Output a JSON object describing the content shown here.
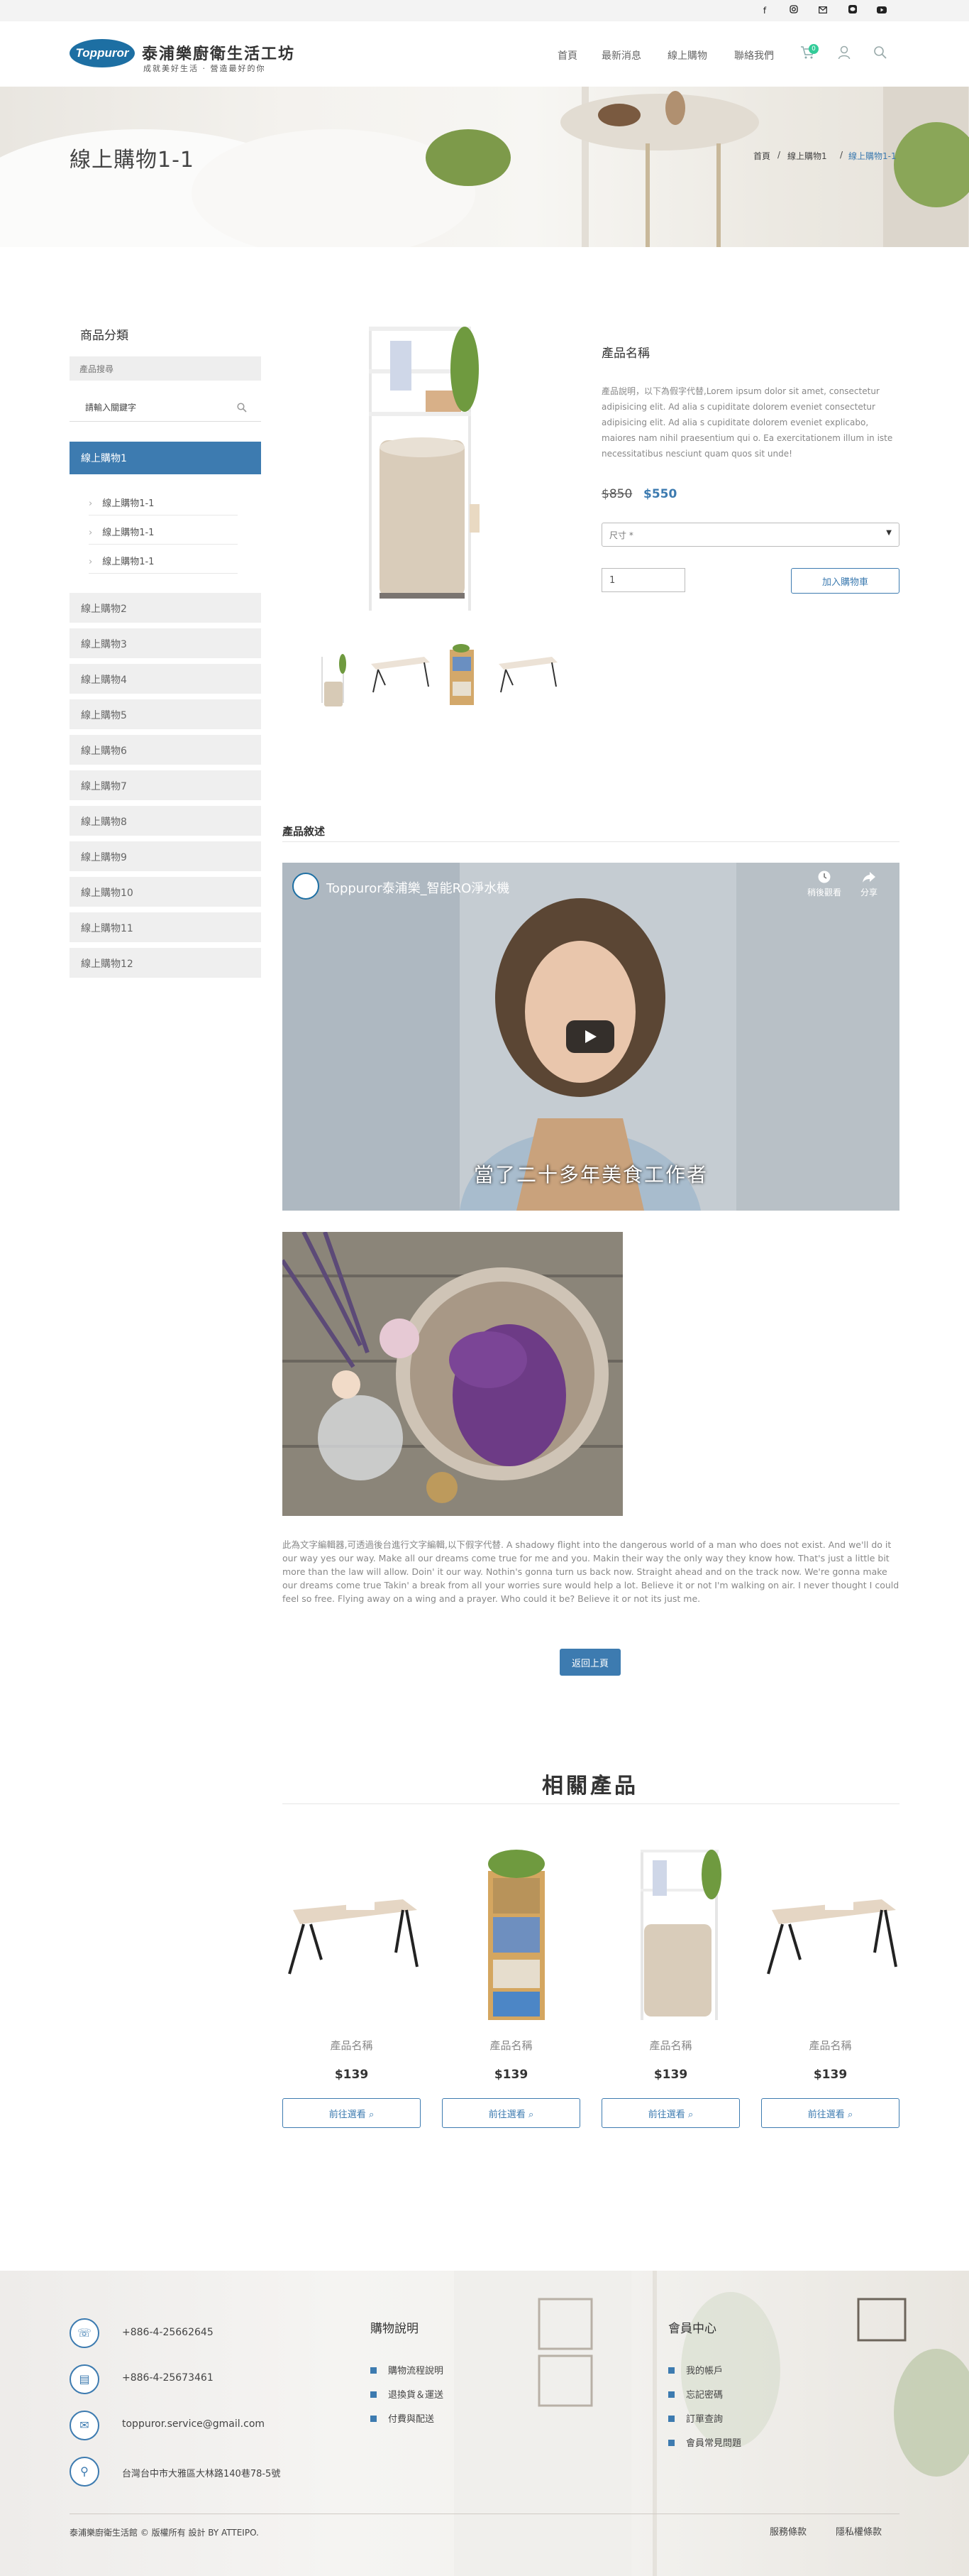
{
  "topbar": {
    "icons": [
      "facebook-icon",
      "instagram-icon",
      "email-icon",
      "line-icon",
      "youtube-icon"
    ]
  },
  "header": {
    "logo_text": "Toppuror",
    "brand": "泰浦樂廚衛生活工坊",
    "tagline": "成就美好生活 · 營造最好的你",
    "nav": [
      "首頁",
      "最新消息",
      "線上購物",
      "聯絡我們"
    ],
    "cart_count": "0"
  },
  "banner": {
    "title": "線上購物1-1",
    "breadcrumb": [
      "首頁",
      "線上購物1",
      "線上購物1-1"
    ],
    "separator": "/"
  },
  "sidebar": {
    "title": "商品分類",
    "search_label": "產品搜尋",
    "search_placeholder": "請輸入關鍵字",
    "active": "線上購物1",
    "sub_items": [
      "線上購物1-1",
      "線上購物1-1",
      "線上購物1-1"
    ],
    "items": [
      "線上購物2",
      "線上購物3",
      "線上購物4",
      "線上購物5",
      "線上購物6",
      "線上購物7",
      "線上購物8",
      "線上購物9",
      "線上購物10",
      "線上購物11",
      "線上購物12"
    ]
  },
  "product": {
    "name": "產品名稱",
    "description": "產品說明，以下為假字代替,Lorem ipsum dolor sit amet, consectetur adipisicing elit. Ad alia s cupiditate dolorem eveniet consectetur adipisicing elit. Ad alia s cupiditate dolorem eveniet explicabo, maiores nam nihil praesentium qui o. Ea exercitationem illum in iste necessitatibus nesciunt quam quos sit unde!",
    "price_old": "$850",
    "price_new": "$550",
    "size_placeholder": "尺寸 *",
    "qty": "1",
    "add_to_cart": "加入購物車"
  },
  "details": {
    "heading": "產品敘述",
    "video_title": "Toppuror泰浦樂_智能RO淨水機",
    "video_watch_later": "稍後觀看",
    "video_share": "分享",
    "video_subtitle": "當了二十多年美食工作者",
    "body": "此為文字編輯器,可透過後台進行文字編輯,以下假字代替. A shadowy flight into the dangerous world of a man who does not exist. And we'll do it our way yes our way. Make all our dreams come true for me and you. Makin their way the only way they know how. That's just a little bit more than the law will allow. Doin' it our way. Nothin's gonna turn us back now. Straight ahead and on the track now. We're gonna make our dreams come true Takin' a break from all your worries sure would help a lot. Believe it or not I'm walking on air. I never thought I could feel so free. Flying away on a wing and a prayer. Who could it be? Believe it or not its just me.",
    "back_button": "返回上頁"
  },
  "related": {
    "title": "相關產品",
    "items": [
      {
        "name": "產品名稱",
        "price": "$139",
        "button": "前往選看"
      },
      {
        "name": "產品名稱",
        "price": "$139",
        "button": "前往選看"
      },
      {
        "name": "產品名稱",
        "price": "$139",
        "button": "前往選看"
      },
      {
        "name": "產品名稱",
        "price": "$139",
        "button": "前往選看"
      }
    ]
  },
  "footer": {
    "phone": "+886-4-25662645",
    "fax": "+886-4-25673461",
    "email": "toppuror.service@gmail.com",
    "address": "台灣台中市大雅區大林路140巷78-5號",
    "col1_title": "購物說明",
    "col1_links": [
      "購物流程說明",
      "退換貨＆運送",
      "付費與配送"
    ],
    "col2_title": "會員中心",
    "col2_links": [
      "我的帳戶",
      "忘記密碼",
      "訂單查詢",
      "會員常見問題"
    ],
    "copyright": "泰浦樂廚衛生活館 © 版權所有 設計 BY ATTEIPO.",
    "bottom_links": [
      "服務條款",
      "隱私權條款"
    ]
  },
  "colors": {
    "accent": "#3d7bb0",
    "price": "#3d7bb0",
    "sidebar_active": "#3d7bb0"
  }
}
